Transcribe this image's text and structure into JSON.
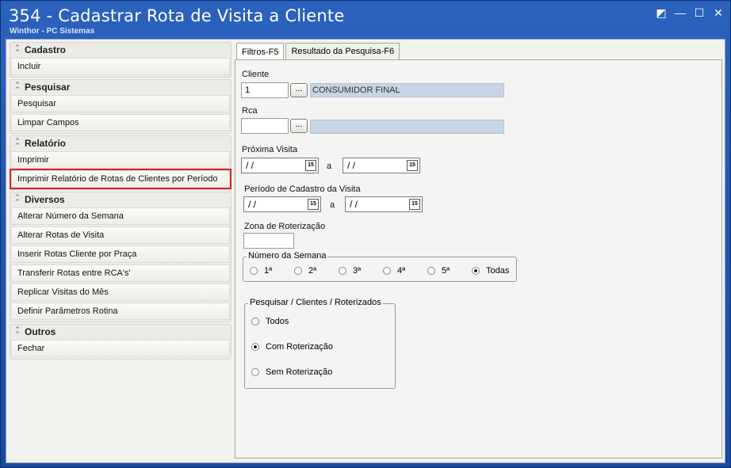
{
  "window": {
    "title": "354 - Cadastrar Rota de Visita a Cliente",
    "subtitle": "Winthor - PC Sistemas"
  },
  "sidebar": {
    "groups": [
      {
        "header": "Cadastro",
        "items": [
          "Incluir"
        ]
      },
      {
        "header": "Pesquisar",
        "items": [
          "Pesquisar",
          "Limpar Campos"
        ]
      },
      {
        "header": "Relatório",
        "items": [
          "Imprimir",
          "Imprimir Relatório de Rotas de Clientes por Período"
        ]
      },
      {
        "header": "Diversos",
        "items": [
          "Alterar Número da Semana",
          "Alterar Rotas de Visita",
          "Inserir Rotas Cliente por Praça",
          "Transferir Rotas entre RCA's'",
          "Replicar Visitas do Mês",
          "Definir Parâmetros Rotina"
        ]
      },
      {
        "header": "Outros",
        "items": [
          "Fechar"
        ]
      }
    ]
  },
  "tabs": [
    "Filtros-F5",
    "Resultado da Pesquisa-F6"
  ],
  "filters": {
    "cliente_label": "Cliente",
    "cliente_code": "1",
    "cliente_name": "CONSUMIDOR FINAL",
    "dots": "...",
    "rca_label": "Rca",
    "rca_code": "",
    "rca_name": "",
    "proxima_label": "Próxima Visita",
    "date_placeholder": " / /",
    "a_label": "a",
    "periodo_label": "Período de Cadastro da Visita",
    "zona_label": "Zona de Roterização",
    "zona_value": "",
    "cal_icon_text": "15",
    "semana_title": "Número da Semana",
    "semana_options": [
      "1ª",
      "2ª",
      "3ª",
      "4ª",
      "5ª",
      "Todas"
    ],
    "semana_selected": "Todas",
    "pesquisar_title": "Pesquisar / Clientes / Roterizados",
    "pesquisar_options": [
      "Todos",
      "Com Roterização",
      "Sem Roterização"
    ],
    "pesquisar_selected": "Com Roterização"
  },
  "colors": {
    "highlight": "#e22020",
    "titlebar": "#2b62bd"
  }
}
